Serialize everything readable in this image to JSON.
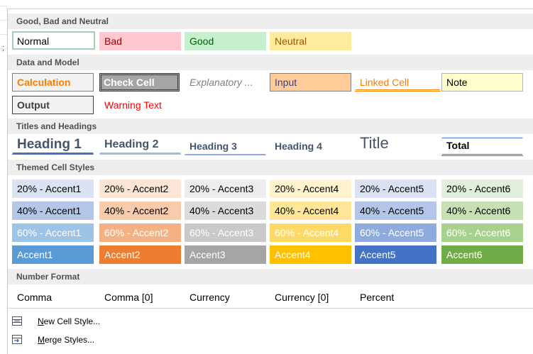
{
  "sections": {
    "good_bad_neutral": "Good, Bad and Neutral",
    "data_model": "Data and Model",
    "titles_headings": "Titles and Headings",
    "themed": "Themed Cell Styles",
    "number_format": "Number Format"
  },
  "good_bad_neutral": [
    "Normal",
    "Bad",
    "Good",
    "Neutral"
  ],
  "data_model": {
    "row1": [
      "Calculation",
      "Check Cell",
      "Explanatory ...",
      "Input",
      "Linked Cell",
      "Note"
    ],
    "row2": [
      "Output",
      "Warning Text"
    ]
  },
  "headings": [
    "Heading 1",
    "Heading 2",
    "Heading 3",
    "Heading 4",
    "Title",
    "Total"
  ],
  "themed": {
    "row20": [
      "20% - Accent1",
      "20% - Accent2",
      "20% - Accent3",
      "20% - Accent4",
      "20% - Accent5",
      "20% - Accent6"
    ],
    "row40": [
      "40% - Accent1",
      "40% - Accent2",
      "40% - Accent3",
      "40% - Accent4",
      "40% - Accent5",
      "40% - Accent6"
    ],
    "row60": [
      "60% - Accent1",
      "60% - Accent2",
      "60% - Accent3",
      "60% - Accent4",
      "60% - Accent5",
      "60% - Accent6"
    ],
    "rowAcc": [
      "Accent1",
      "Accent2",
      "Accent3",
      "Accent4",
      "Accent5",
      "Accent6"
    ]
  },
  "number_format": [
    "Comma",
    "Comma [0]",
    "Currency",
    "Currency [0]",
    "Percent"
  ],
  "menu": {
    "new_style_first": "N",
    "new_style_rest": "ew Cell Style...",
    "merge_first": "M",
    "merge_rest": "erge Styles..."
  },
  "side": {
    "mark": ";"
  },
  "colors": {
    "accent1": "#5b9bd5",
    "accent2": "#ed7d31",
    "accent3": "#a5a5a5",
    "accent4": "#ffc000",
    "accent5": "#4472c4",
    "accent6": "#70ad47"
  },
  "icons": {
    "new_style": "cell-style-icon",
    "merge": "merge-styles-icon"
  }
}
